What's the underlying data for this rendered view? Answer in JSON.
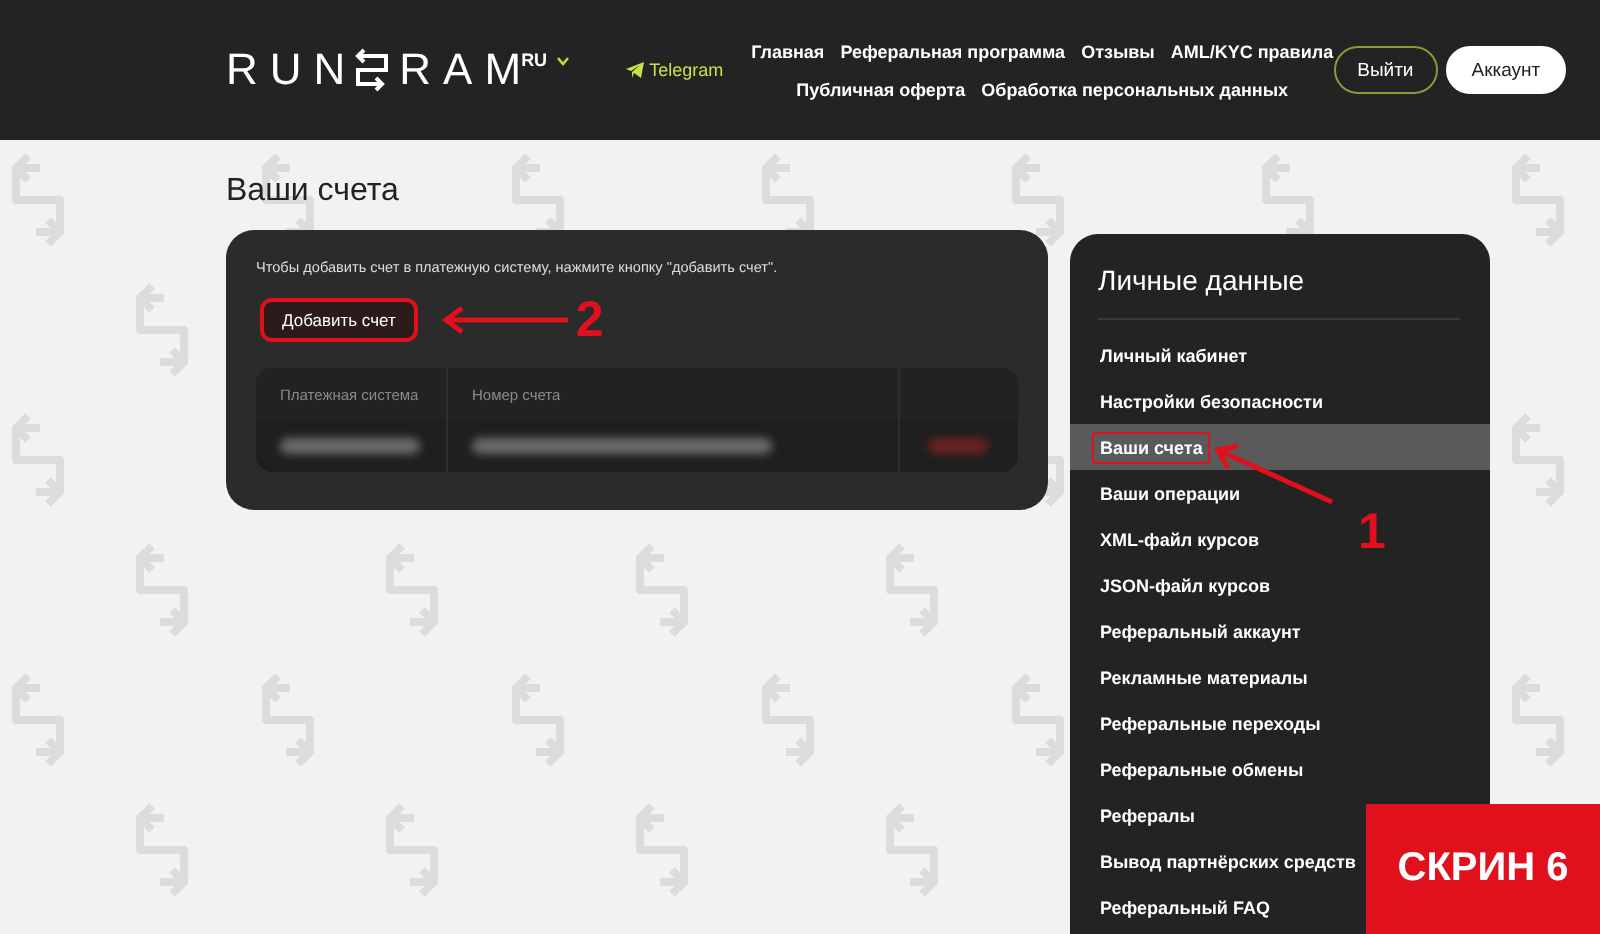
{
  "header": {
    "logo": {
      "left": "RUN",
      "right": "RAM"
    },
    "language": "RU",
    "telegram": "Telegram",
    "nav": [
      [
        "Главная",
        "Реферальная программа",
        "Отзывы",
        "AML/KYC правила"
      ],
      [
        "Публичная оферта",
        "Обработка персональных данных"
      ]
    ],
    "buttons": [
      {
        "label": "Выйти",
        "kind": "outline"
      },
      {
        "label": "Аккаунт",
        "kind": "solid"
      }
    ]
  },
  "page_title": "Ваши счета",
  "accounts_card": {
    "hint": "Чтобы добавить счет в платежную систему, нажмите кнопку \"добавить счет\".",
    "add_button": {
      "label": "Добавить счет",
      "highlighted": true
    },
    "table": {
      "columns": [
        "Платежная система",
        "Номер счета"
      ],
      "rows": [
        {
          "redacted": true
        }
      ]
    }
  },
  "sidebar": {
    "title": "Личные данные",
    "items": [
      {
        "label": "Личный кабинет",
        "selected": false,
        "highlighted": false
      },
      {
        "label": "Настройки безопасности",
        "selected": false,
        "highlighted": false
      },
      {
        "label": "Ваши счета",
        "selected": true,
        "highlighted": true
      },
      {
        "label": "Ваши операции",
        "selected": false,
        "highlighted": false
      },
      {
        "label": "XML-файл курсов",
        "selected": false,
        "highlighted": false
      },
      {
        "label": "JSON-файл курсов",
        "selected": false,
        "highlighted": false
      },
      {
        "label": "Реферальный аккаунт",
        "selected": false,
        "highlighted": false
      },
      {
        "label": "Рекламные материалы",
        "selected": false,
        "highlighted": false
      },
      {
        "label": "Реферальные переходы",
        "selected": false,
        "highlighted": false
      },
      {
        "label": "Реферальные обмены",
        "selected": false,
        "highlighted": false
      },
      {
        "label": "Рефералы",
        "selected": false,
        "highlighted": false
      },
      {
        "label": "Вывод партнёрских средств",
        "selected": false,
        "highlighted": false
      },
      {
        "label": "Реферальный FAQ",
        "selected": false,
        "highlighted": false
      }
    ]
  },
  "annotations": {
    "button_marker": "2",
    "menu_marker": "1",
    "badge": "СКРИН 6"
  }
}
